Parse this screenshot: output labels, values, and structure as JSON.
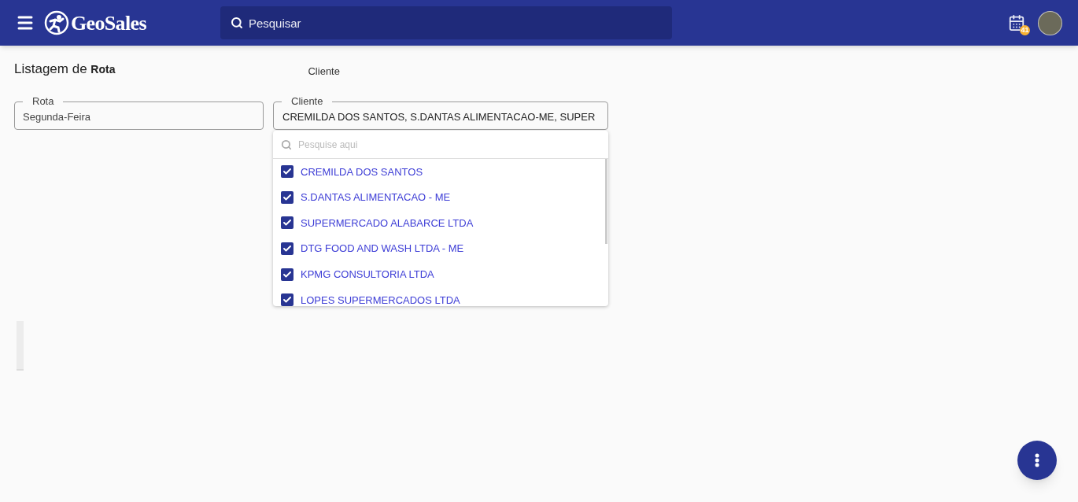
{
  "header": {
    "brand": "GeoSales",
    "search": {
      "placeholder": "Pesquisar"
    },
    "calendar_badge": "41"
  },
  "page": {
    "title": "Listagem de",
    "title_strong": "Rota",
    "floating_label": "Cliente"
  },
  "fields": [
    {
      "label": "Rota",
      "value": "Segunda-Feira"
    },
    {
      "label": "Cliente",
      "value": "CREMILDA DOS SANTOS, S.DANTAS ALIMENTACAO-ME, SUPER"
    }
  ],
  "dropdown": {
    "search": {
      "placeholder": "Pesquise aqui"
    },
    "options": [
      {
        "label": "CREMILDA DOS SANTOS",
        "checked": true
      },
      {
        "label": "S.DANTAS ALIMENTACAO - ME",
        "checked": true
      },
      {
        "label": "SUPERMERCADO ALABARCE LTDA",
        "checked": true
      },
      {
        "label": "DTG FOOD AND WASH LTDA - ME",
        "checked": true
      },
      {
        "label": "KPMG CONSULTORIA LTDA",
        "checked": true
      },
      {
        "label": "LOPES SUPERMERCADOS LTDA",
        "checked": true
      }
    ]
  }
}
